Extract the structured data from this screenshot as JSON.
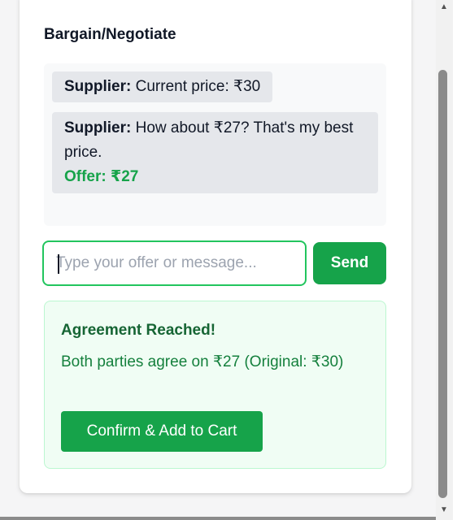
{
  "bargain": {
    "title": "Bargain/Negotiate",
    "messages": [
      {
        "sender": "Supplier:",
        "text": " Current price: ₹30"
      },
      {
        "sender": "Supplier:",
        "text": " How about ₹27? That's my best price.",
        "offer": "Offer: ₹27"
      }
    ],
    "input_placeholder": "Type your offer or message...",
    "input_value": "",
    "send_label": "Send"
  },
  "agreement": {
    "title": "Agreement Reached!",
    "text": "Both parties agree on ₹27 (Original: ₹30)",
    "confirm_label": "Confirm & Add to Cart"
  },
  "colors": {
    "accent": "#16a34a",
    "success_bg": "#f0fdf4",
    "success_text": "#166534"
  }
}
